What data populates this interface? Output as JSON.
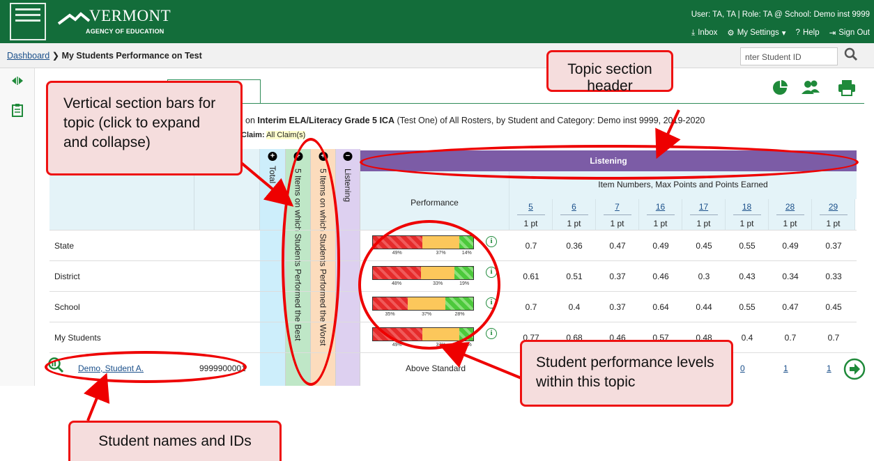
{
  "header": {
    "brand_title": "VERMONT",
    "brand_subtitle": "AGENCY OF EDUCATION",
    "user_info": "User: TA, TA  |  Role: TA @ School: Demo inst 9999",
    "inbox": "Inbox",
    "settings": "My Settings",
    "help": "Help",
    "sign_out": "Sign Out"
  },
  "breadcrumb": {
    "home": "Dashboard",
    "current": "My Students Performance on Test"
  },
  "search": {
    "placeholder": "Enter Student ID",
    "value": "nter Student ID"
  },
  "tab": {
    "label": "ent"
  },
  "report": {
    "subtitle_prefix": "on ",
    "subtitle_test": "Interim ELA/Literacy Grade 5 ICA",
    "subtitle_rest": " (Test One) of All Rosters, by Student and Category: Demo inst 9999, 2019-2020",
    "claim_label": "Claim:",
    "claim_value": "All Claim(s)"
  },
  "vbars": {
    "total": "Total",
    "best": "5 Items on which Students Performed the Best",
    "worst": "5 Items on which Students Performed the Worst",
    "listening": "Listening"
  },
  "topic": {
    "title": "Listening",
    "item_header": "Item Numbers, Max Points and Points Earned",
    "performance_header": "Performance",
    "items": [
      {
        "num": "5",
        "pts": "1 pt"
      },
      {
        "num": "6",
        "pts": "1 pt"
      },
      {
        "num": "7",
        "pts": "1 pt"
      },
      {
        "num": "16",
        "pts": "1 pt"
      },
      {
        "num": "17",
        "pts": "1 pt"
      },
      {
        "num": "18",
        "pts": "1 pt"
      },
      {
        "num": "28",
        "pts": "1 pt"
      },
      {
        "num": "29",
        "pts": "1 pt"
      }
    ]
  },
  "rows": [
    {
      "label": "State",
      "perf": [
        49,
        37,
        14
      ],
      "perf_labels": [
        "49%",
        "37%",
        "14%"
      ],
      "values": [
        "0.7",
        "0.36",
        "0.47",
        "0.49",
        "0.45",
        "0.55",
        "0.49",
        "0.37"
      ]
    },
    {
      "label": "District",
      "perf": [
        48,
        33,
        19
      ],
      "perf_labels": [
        "48%",
        "33%",
        "19%"
      ],
      "values": [
        "0.61",
        "0.51",
        "0.37",
        "0.46",
        "0.3",
        "0.43",
        "0.34",
        "0.33"
      ]
    },
    {
      "label": "School",
      "perf": [
        35,
        37,
        28
      ],
      "perf_labels": [
        "35%",
        "37%",
        "28%"
      ],
      "values": [
        "0.7",
        "0.4",
        "0.37",
        "0.64",
        "0.44",
        "0.55",
        "0.47",
        "0.45"
      ]
    },
    {
      "label": "My Students",
      "perf": [
        49,
        37,
        14
      ],
      "perf_labels": [
        "49%",
        "37%",
        "14%"
      ],
      "values": [
        "0.77",
        "0.68",
        "0.46",
        "0.57",
        "0.48",
        "0.4",
        "0.7",
        "0.7"
      ]
    }
  ],
  "student": {
    "name": "Demo, Student A.",
    "id": "9999900001",
    "level": "Above Standard",
    "values": [
      "0",
      "1",
      "1"
    ]
  },
  "callouts": {
    "vertical_bars": "Vertical section bars for topic (click to expand and collapse)",
    "topic_header": "Topic section header",
    "performance": "Student performance levels within this topic",
    "student_names": "Student names and IDs"
  },
  "colors": {
    "header_green": "#136d3a",
    "topic_purple": "#7c5ca6",
    "callout_red": "#e11111"
  }
}
